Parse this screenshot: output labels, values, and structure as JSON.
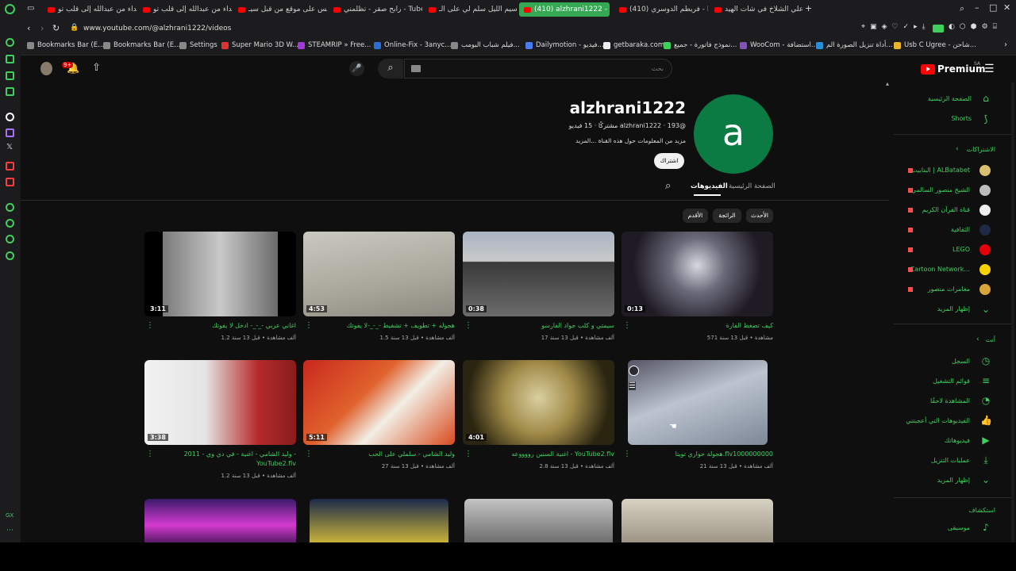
{
  "browser": {
    "tabs": [
      {
        "label": "اهداء من عبدالله إلى قلب تو..."
      },
      {
        "label": "اهداء من عبدالله إلى قلب تو..."
      },
      {
        "label": "دعس على موقع من قبل سيـ..."
      },
      {
        "label": "رابح صقر - تظلمني - Tube"
      },
      {
        "label": "ياسيم الليل سلم لي على الـ..."
      },
      {
        "label": "(410) alzhrani1222 - You..."
      },
      {
        "label": "(410) فريطم الدوسري - be"
      },
      {
        "label": "بو علي الشلاخ في شات الهيد..."
      }
    ],
    "url": "www.youtube.com/@alzhrani1222/videos",
    "bookmarks": [
      "Bookmarks Bar (E...",
      "Bookmarks Bar (E...",
      "Settings",
      "Super Mario 3D W...",
      "STEAMRIP » Free...",
      "Online-Fix - 3anyc...",
      "فيلم شباب البومب...",
      "Dailymotion - فيديو...",
      "getbaraka.com",
      "نموذج فاتورة - جميع...",
      "WooCom - استضافة...",
      "أداة تنزيل الصورة الم...",
      "Usb C Ugree - شاحن..."
    ],
    "left_label_gx": "GX"
  },
  "header": {
    "search_placeholder": "بحث",
    "logo_text": "Premium",
    "logo_region": "SA",
    "notif_count": "9+"
  },
  "channel": {
    "avatar_letter": "a",
    "name": "alzhrani1222",
    "handle_line": "@alzhrani1222 ‧ 193 مشتركًا ‧ 15 فيديو",
    "about": "مزيد من المعلومات حول هذه القناة ...المزيد",
    "subscribe_label": "اشتراك",
    "tabs": [
      "الصفحة الرئيسية",
      "الفيديوهات"
    ],
    "chips": [
      "الأحدث",
      "الرائجة",
      "الأقدم"
    ]
  },
  "videos": [
    {
      "title": "كيف تضغط الفارة",
      "meta": "571 مشاهدة • قبل 13 سنة",
      "duration": "0:13"
    },
    {
      "title": "سيمتي و كلب جواد الفارسو",
      "meta": "17 ألف مشاهدة • قبل 13 سنة",
      "duration": "0:38"
    },
    {
      "title": "هجوله + تطويف + تشفيط -_-_-لا يفوتك",
      "meta": "1.5 ألف مشاهدة • قبل 13 سنة",
      "duration": "4:53"
    },
    {
      "title": "اغاني عربي -_-_- ادخل لا يفوتك",
      "meta": "1.2 ألف مشاهدة • قبل 13 سنة",
      "duration": "3:11"
    },
    {
      "title": "هجولة حواري تويتا.flv1000000000",
      "meta": "21 ألف مشاهدة • قبل 13 سنة",
      "duration": ""
    },
    {
      "title": "اغنية السنين رووووعه - YouTube2.flv",
      "meta": "2.8 ألف مشاهدة • قبل 13 سنة",
      "duration": "4:01"
    },
    {
      "title": "وليد الشامي - سلملي على الحب",
      "meta": "27 ألف مشاهدة • قبل 13 سنة",
      "duration": "5:11"
    },
    {
      "title": "وليد الشامي - اغنية - في دي وي - 2011 - YouTube2.flv",
      "meta": "1.2 ألف مشاهدة • قبل 13 سنة",
      "duration": "3:38"
    }
  ],
  "right_sidebar": {
    "home": "الصفحة الرئيسية",
    "shorts": "Shorts",
    "subs_header": "الاشتراكات",
    "subscriptions": [
      "البتابيت | ALBatabet",
      "الشيخ منصور السالمي",
      "قناة القرآن الكريم",
      "الثقافية",
      "LEGO",
      "Cartoon Network...",
      "مغامرات منصور",
      "إظهار المزيد"
    ],
    "you_header": "أنت",
    "you_items": [
      "السجل",
      "قوائم التشغيل",
      "المشاهدة لاحقًا",
      "الفيديوهات التي أعجبتني",
      "فيديوهاتك",
      "عمليات التنزيل",
      "إظهار المزيد"
    ],
    "explore_header": "استكشاف",
    "music": "موسيقى"
  },
  "colors": {
    "accent": "#3ecf5d",
    "bg": "#0f0f0f",
    "chrome": "#1c1c1e",
    "yt_red": "#ff0000",
    "avatar": "#0b7a43"
  }
}
